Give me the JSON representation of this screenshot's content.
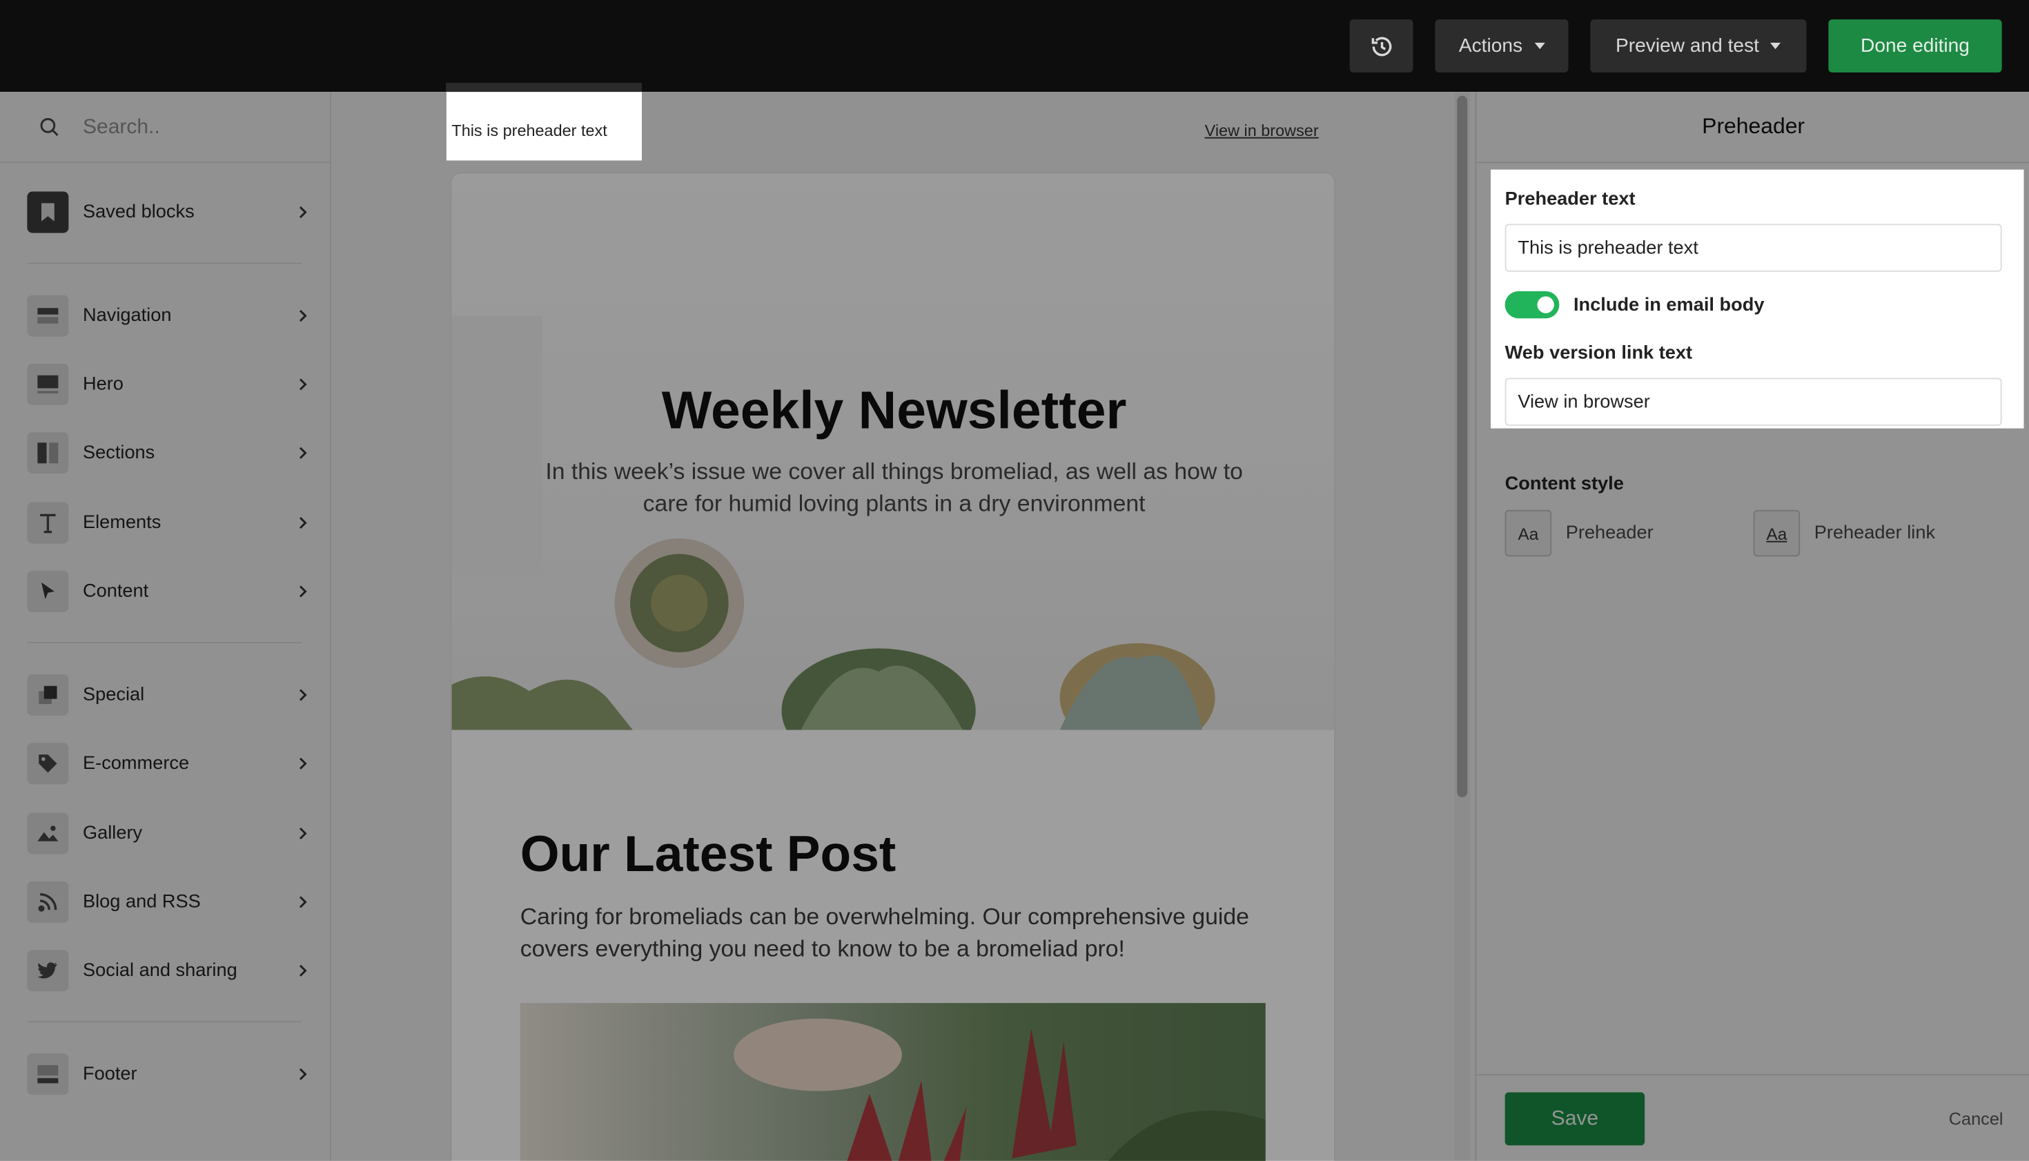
{
  "topbar": {
    "history_icon": "history-icon",
    "actions_label": "Actions",
    "preview_label": "Preview and test",
    "done_label": "Done editing",
    "done_color": "#1d8a43"
  },
  "sidebar": {
    "search_placeholder": "Search..",
    "items": [
      {
        "label": "Saved blocks",
        "icon": "bookmark-icon"
      },
      {
        "label": "Navigation",
        "icon": "navigation-block-icon"
      },
      {
        "label": "Hero",
        "icon": "hero-block-icon"
      },
      {
        "label": "Sections",
        "icon": "sections-icon"
      },
      {
        "label": "Elements",
        "icon": "text-icon"
      },
      {
        "label": "Content",
        "icon": "cursor-icon"
      },
      {
        "label": "Special",
        "icon": "special-icon"
      },
      {
        "label": "E-commerce",
        "icon": "tag-icon"
      },
      {
        "label": "Gallery",
        "icon": "image-icon"
      },
      {
        "label": "Blog and RSS",
        "icon": "rss-icon"
      },
      {
        "label": "Social and sharing",
        "icon": "twitter-icon"
      },
      {
        "label": "Footer",
        "icon": "footer-block-icon"
      }
    ]
  },
  "canvas": {
    "preheader_text": "This is preheader text",
    "view_in_browser": "View in browser",
    "hero_title": "Weekly Newsletter",
    "hero_subtitle": "In this week’s issue we cover all things bromeliad, as well as how to care for humid loving plants in a dry environment",
    "post_title": "Our Latest Post",
    "post_body": "Caring for bromeliads can be overwhelming. Our comprehensive guide covers everything you need to know to be a bromeliad pro!"
  },
  "panel": {
    "title": "Preheader",
    "preheader_label": "Preheader text",
    "preheader_value": "This is preheader text",
    "toggle_label": "Include in email body",
    "toggle_on": true,
    "web_link_label": "Web version link text",
    "web_link_value": "View in browser",
    "content_style_label": "Content style",
    "style_chip_glyph": "Aa",
    "style_preheader": "Preheader",
    "style_preheader_link": "Preheader link",
    "save_label": "Save",
    "cancel_label": "Cancel",
    "accent": "#22b45a"
  }
}
